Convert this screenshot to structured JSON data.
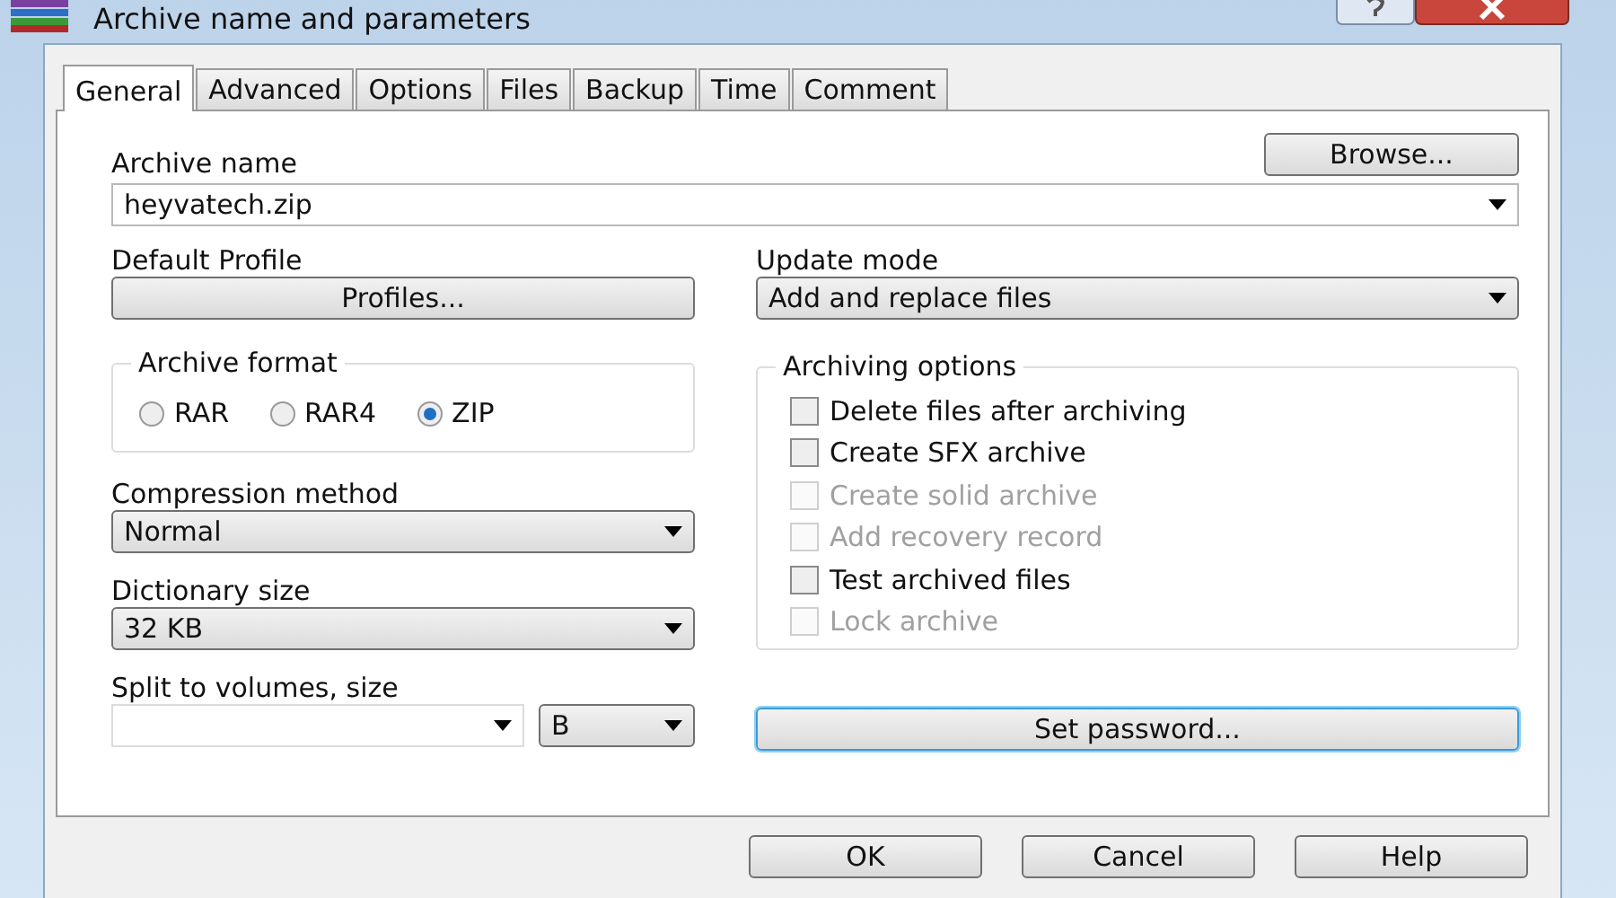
{
  "window": {
    "title": "Archive name and parameters"
  },
  "tabs": [
    {
      "label": "General",
      "selected": true
    },
    {
      "label": "Advanced",
      "selected": false
    },
    {
      "label": "Options",
      "selected": false
    },
    {
      "label": "Files",
      "selected": false
    },
    {
      "label": "Backup",
      "selected": false
    },
    {
      "label": "Time",
      "selected": false
    },
    {
      "label": "Comment",
      "selected": false
    }
  ],
  "archive_name": {
    "label": "Archive name",
    "value": "heyvatech.zip",
    "browse_button": "Browse..."
  },
  "default_profile": {
    "label": "Default Profile",
    "button": "Profiles..."
  },
  "update_mode": {
    "label": "Update mode",
    "value": "Add and replace files"
  },
  "archive_format": {
    "label": "Archive format",
    "options": [
      {
        "label": "RAR",
        "selected": false
      },
      {
        "label": "RAR4",
        "selected": false
      },
      {
        "label": "ZIP",
        "selected": true
      }
    ]
  },
  "archiving_options": {
    "label": "Archiving options",
    "items": [
      {
        "label": "Delete files after archiving",
        "checked": false,
        "disabled": false
      },
      {
        "label": "Create SFX archive",
        "checked": false,
        "disabled": false
      },
      {
        "label": "Create solid archive",
        "checked": false,
        "disabled": true
      },
      {
        "label": "Add recovery record",
        "checked": false,
        "disabled": true
      },
      {
        "label": "Test archived files",
        "checked": false,
        "disabled": false
      },
      {
        "label": "Lock archive",
        "checked": false,
        "disabled": true
      }
    ]
  },
  "compression_method": {
    "label": "Compression method",
    "value": "Normal"
  },
  "dictionary_size": {
    "label": "Dictionary size",
    "value": "32 KB"
  },
  "split_volumes": {
    "label": "Split to volumes, size",
    "unit": "B"
  },
  "set_password_button": "Set password...",
  "buttons": [
    "OK",
    "Cancel",
    "Help"
  ]
}
